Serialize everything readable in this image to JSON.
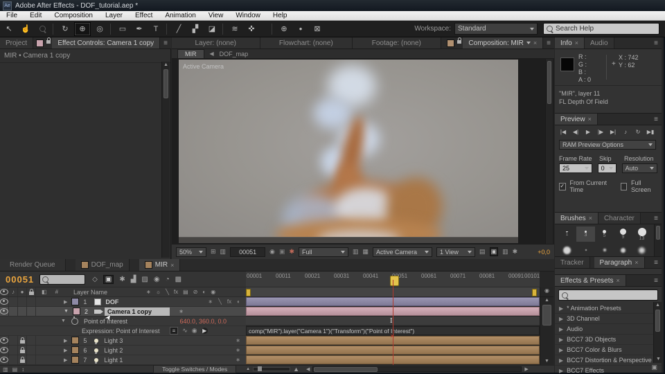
{
  "window": {
    "title": "Adobe After Effects - DOF_tutorial.aep *",
    "app_icon": "Ae",
    "menus": [
      "File",
      "Edit",
      "Composition",
      "Layer",
      "Effect",
      "Animation",
      "View",
      "Window",
      "Help"
    ]
  },
  "toolbar": {
    "workspace_label": "Workspace:",
    "workspace_value": "Standard",
    "search": "Search Help"
  },
  "icons": {
    "panel_menu": "≡",
    "close": "×",
    "tri_right": "▶",
    "tri_down": "▼",
    "back": "◀",
    "tool_selection": "↖",
    "tool_hand": "☝",
    "tool_rotate": "↻",
    "tool_orbit": "⊕",
    "tool_camera": "◎",
    "tool_rect": "▭",
    "tool_pen": "✒",
    "tool_text": "T",
    "tool_brush": "╱",
    "tool_stamp": "▞",
    "tool_eraser": "◪",
    "tool_roto": "≋",
    "tool_puppet": "✜",
    "axis1": "⊕",
    "axis2": "●",
    "axis3": "⊠",
    "t_start": "|◀",
    "t_prev": "◀|",
    "t_play": "▶",
    "t_next": "|▶",
    "t_end": "▶|",
    "t_audio": "♪",
    "t_loop": "↻",
    "t_ram": "▶▮",
    "speaker": "♪",
    "solo": "●",
    "tag": "◧",
    "hash": "#",
    "sw1": "∗",
    "sw2": "☼",
    "sw3": "╲",
    "sw4": "fx",
    "sw5": "▤",
    "sw6": "⊘",
    "sw7": "◐",
    "sw8": "◉",
    "expr_eq": "=",
    "expr_graph": "∿",
    "expr_pick": "◉",
    "expr_play": "▶",
    "tl1": "◇",
    "tl2": "▣",
    "tl3": "✱",
    "tl4": "▟",
    "tl5": "▨",
    "tl6": "◉",
    "tl7": "◔",
    "tl8": "▩",
    "snapshot": "◉",
    "show_snap": "▣",
    "channels": "✱",
    "margins": "⊞",
    "roi": "▥",
    "region": "▥",
    "grid": "▦",
    "view_opt1": "▤",
    "view_opt2": "▣",
    "view_opt3": "▥",
    "pipeline": "⚒",
    "exposure": "✳",
    "mountain": "▲",
    "cursor": "➤",
    "ibeam": "I",
    "red_x": "✕",
    "corner_btn": "▣",
    "bottom1": "▥",
    "bottom2": "▤",
    "bottom3": "↕"
  },
  "left_panel": {
    "tab_project": "Project",
    "tab_effect_controls": "Effect Controls: Camera 1 copy",
    "breadcrumb": "MIR • Camera 1 copy"
  },
  "viewer": {
    "tab_layer": "Layer: (none)",
    "tab_flowchart": "Flowchart: (none)",
    "tab_footage": "Footage: (none)",
    "tab_comp": "Composition: MIR",
    "comp_tab_mir": "MIR",
    "comp_tab_dof": "DOF_map",
    "overlay": "Active Camera",
    "zoom": "50%",
    "timecode": "00051",
    "channels": "Full",
    "camera": "Active Camera",
    "views": "1 View",
    "exposure": "+0,0"
  },
  "info": {
    "tab": "Info",
    "tab_audio": "Audio",
    "r": "R :",
    "g": "G :",
    "b": "B :",
    "a": "A : 0",
    "x": "X : 742",
    "y": "Y : 62",
    "plus": "+",
    "line1": "\"MIR\", layer 11",
    "line2": "FL Depth Of Field"
  },
  "preview": {
    "tab": "Preview",
    "ram_options": "RAM Preview Options",
    "frame_rate_label": "Frame Rate",
    "frame_rate": "25",
    "skip_label": "Skip",
    "skip": "0",
    "resolution_label": "Resolution",
    "resolution": "Auto",
    "check": "✓",
    "from_current": "From Current Time",
    "full_screen": "Full Screen"
  },
  "brushes": {
    "tab": "Brushes",
    "tab_character": "Character",
    "sizes": [
      "1",
      "3",
      "5",
      "9",
      "13"
    ]
  },
  "tp": {
    "tab_tracker": "Tracker",
    "tab_paragraph": "Paragraph"
  },
  "effects": {
    "tab": "Effects & Presets",
    "items": [
      "* Animation Presets",
      "3D Channel",
      "Audio",
      "BCC7 3D Objects",
      "BCC7 Color & Blurs",
      "BCC7 Distortion & Perspective",
      "BCC7 Effects"
    ]
  },
  "timeline": {
    "tab_render": "Render Queue",
    "tab_dof": "DOF_map",
    "tab_mir": "MIR",
    "time": "00051",
    "layer_name_header": "Layer Name",
    "ticks": [
      "00001",
      "00011",
      "00021",
      "00031",
      "00041",
      "00051",
      "00061",
      "00071",
      "00081",
      "00091",
      "00101"
    ],
    "toggle": "Toggle Switches / Modes",
    "poi_label": "Point of Interest",
    "poi_values": "640.0, 360.0, 0.0",
    "expr_label": "Expression: Point of Interest",
    "expr": "comp(\"MIR\").layer(\"Camera 1\")(\"Transform\")(\"Point of Interest\")",
    "layers": [
      {
        "n": "1",
        "name": "DOF"
      },
      {
        "n": "2",
        "name": "Camera 1 copy"
      },
      {
        "n": "5",
        "name": "Light 3"
      },
      {
        "n": "6",
        "name": "Light 2"
      },
      {
        "n": "7",
        "name": "Light 1"
      }
    ]
  },
  "colors": {
    "bar_dof": "#8e8aa6",
    "bar_camera": "#c8a3ad",
    "bar_light": "#a5835d",
    "playhead": "#b23a2e",
    "time_orange": "#eca63e",
    "value_red": "#cf6a5a"
  }
}
